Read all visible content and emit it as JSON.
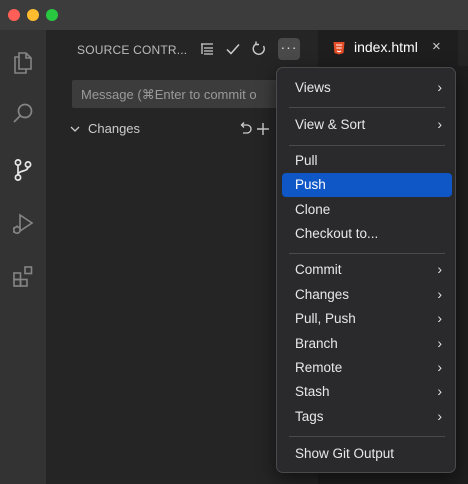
{
  "sidebar": {
    "title": "SOURCE CONTR...",
    "more_label": "···",
    "message_placeholder": "Message (⌘Enter to commit o",
    "changes_label": "Changes"
  },
  "tab": {
    "label": "index.html",
    "close": "×"
  },
  "menu": {
    "items": [
      {
        "label": "Views",
        "submenu": "›"
      },
      {
        "label": "View & Sort",
        "submenu": "›"
      },
      {
        "label": "Pull"
      },
      {
        "label": "Push",
        "active": true
      },
      {
        "label": "Clone"
      },
      {
        "label": "Checkout to..."
      },
      {
        "label": "Commit",
        "submenu": "›"
      },
      {
        "label": "Changes",
        "submenu": "›"
      },
      {
        "label": "Pull, Push",
        "submenu": "›"
      },
      {
        "label": "Branch",
        "submenu": "›"
      },
      {
        "label": "Remote",
        "submenu": "›"
      },
      {
        "label": "Stash",
        "submenu": "›"
      },
      {
        "label": "Tags",
        "submenu": "›"
      },
      {
        "label": "Show Git Output"
      }
    ]
  },
  "colors": {
    "accent": "#0f56c7",
    "html_icon": "#e44d26",
    "titlebar": "#3c3c3c",
    "activitybar": "#333333",
    "sidebar": "#252526"
  },
  "icons": [
    "explorer-icon",
    "search-icon",
    "source-control-icon",
    "run-debug-icon",
    "extensions-icon",
    "view-as-tree-icon",
    "commit-check-icon",
    "refresh-icon",
    "more-actions-icon",
    "chevron-down-icon",
    "discard-changes-icon",
    "stage-all-icon",
    "html-file-icon",
    "close-icon",
    "submenu-arrow-icon"
  ]
}
